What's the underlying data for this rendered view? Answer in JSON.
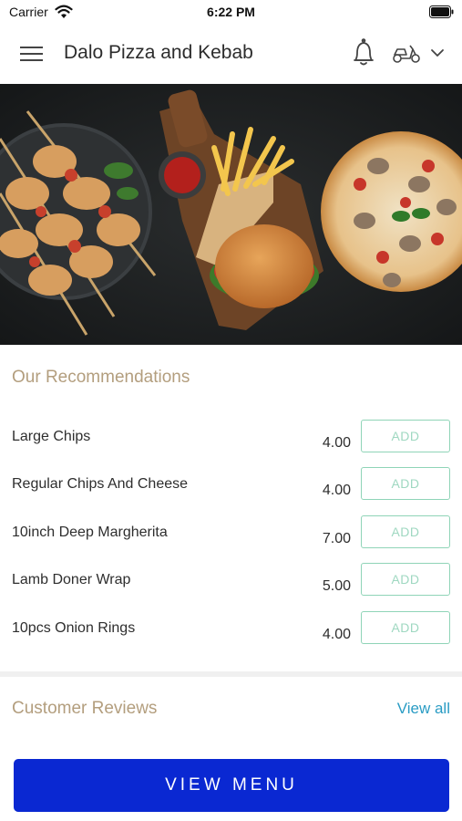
{
  "status_bar": {
    "carrier": "Carrier",
    "time": "6:22 PM"
  },
  "header": {
    "title": "Dalo Pizza and Kebab",
    "icons": [
      "menu-icon",
      "bell-icon",
      "scooter-icon",
      "chevron-down-icon"
    ]
  },
  "recommendations": {
    "title": "Our Recommendations",
    "items": [
      {
        "name": "Large Chips",
        "price": "4.00",
        "button": "ADD"
      },
      {
        "name": "Regular Chips And Cheese",
        "price": "4.00",
        "button": "ADD"
      },
      {
        "name": "10inch Deep Margherita",
        "price": "7.00",
        "button": "ADD"
      },
      {
        "name": "Lamb Doner Wrap",
        "price": "5.00",
        "button": "ADD"
      },
      {
        "name": "10pcs Onion Rings",
        "price": "4.00",
        "button": "ADD"
      }
    ]
  },
  "reviews": {
    "title": "Customer Reviews",
    "view_all": "View all"
  },
  "cta": {
    "label": "VIEW MENU"
  },
  "colors": {
    "accent_gold": "#b39e7e",
    "add_border": "#8fd4b7",
    "link_blue": "#2a9cc4",
    "cta_blue": "#0a28d2"
  }
}
